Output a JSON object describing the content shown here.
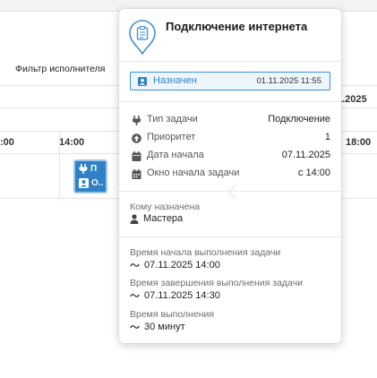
{
  "background": {
    "filter_label": "Фильтр исполнителя",
    "date_partial": "1.2025",
    "times": [
      ":00",
      "14:00",
      "18:00"
    ],
    "task_card": {
      "line1": "П",
      "line2": "О.."
    }
  },
  "popup": {
    "title": "Подключение интернета",
    "status": {
      "label": "Назначен",
      "date": "01.11.2025 11:55",
      "color": "#2f80c5"
    },
    "props": [
      {
        "icon": "plug-icon",
        "key": "Тип задачи",
        "value": "Подключение"
      },
      {
        "icon": "priority-icon",
        "key": "Приоритет",
        "value": "1"
      },
      {
        "icon": "calendar-icon",
        "key": "Дата начала",
        "value": "07.11.2025"
      },
      {
        "icon": "calendar-range-icon",
        "key": "Окно начала задачи",
        "value": "с 14:00"
      }
    ],
    "assigned": {
      "label": "Кому назначена",
      "value": "Мастера"
    },
    "times": {
      "start_label": "Время начала выполнения задачи",
      "start_value": "07.11.2025 14:00",
      "end_label": "Время завершения выполнения задачи",
      "end_value": "07.11.2025 14:30",
      "duration_label": "Время выполнения",
      "duration_value": "30 минут"
    }
  }
}
